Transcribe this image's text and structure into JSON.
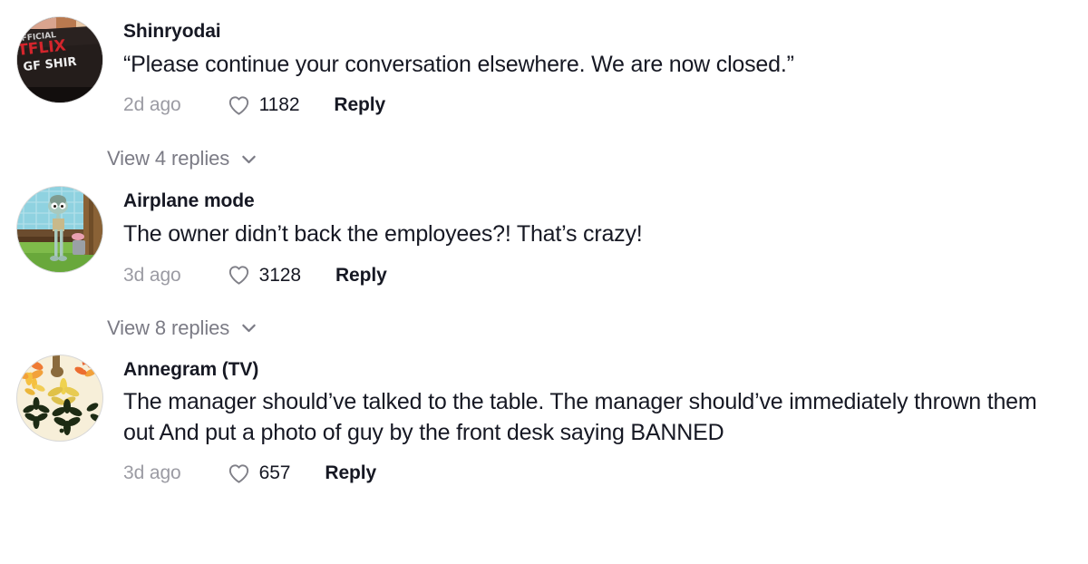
{
  "feed": {
    "comments": [
      {
        "id": "comment-1",
        "username": "Shinryodai",
        "text": "“Please continue your conversation elsewhere. We are now closed.”",
        "time": "2d ago",
        "like_count": "1182",
        "reply_label": "Reply",
        "like_icon": "heart-icon",
        "avatar_alt": "netflix-shirt-photo-avatar",
        "replies": {
          "label": "View 4 replies",
          "count": "4",
          "chevron_icon": "chevron-down-icon"
        }
      },
      {
        "id": "comment-2",
        "username": "Airplane mode",
        "text": "The owner didn’t back the employees?! That’s crazy!",
        "time": "3d ago",
        "like_count": "3128",
        "reply_label": "Reply",
        "like_icon": "heart-icon",
        "avatar_alt": "squidward-cartoon-avatar",
        "replies": {
          "label": "View 8 replies",
          "count": "8",
          "chevron_icon": "chevron-down-icon"
        }
      },
      {
        "id": "comment-3",
        "username": "Annegram (TV)",
        "text": "The manager should’ve talked to the table. The manager should’ve immediately thrown them out And put a photo of guy by the front desk saying BANNED",
        "time": "3d ago",
        "like_count": "657",
        "reply_label": "Reply",
        "like_icon": "heart-icon",
        "avatar_alt": "floral-pattern-avatar",
        "replies": null
      }
    ]
  },
  "colors": {
    "background": "#ffffff",
    "text_primary": "#161823",
    "text_muted": "#9b9ba3",
    "text_replies": "#7b7b85",
    "icon_stroke": "#808088"
  }
}
